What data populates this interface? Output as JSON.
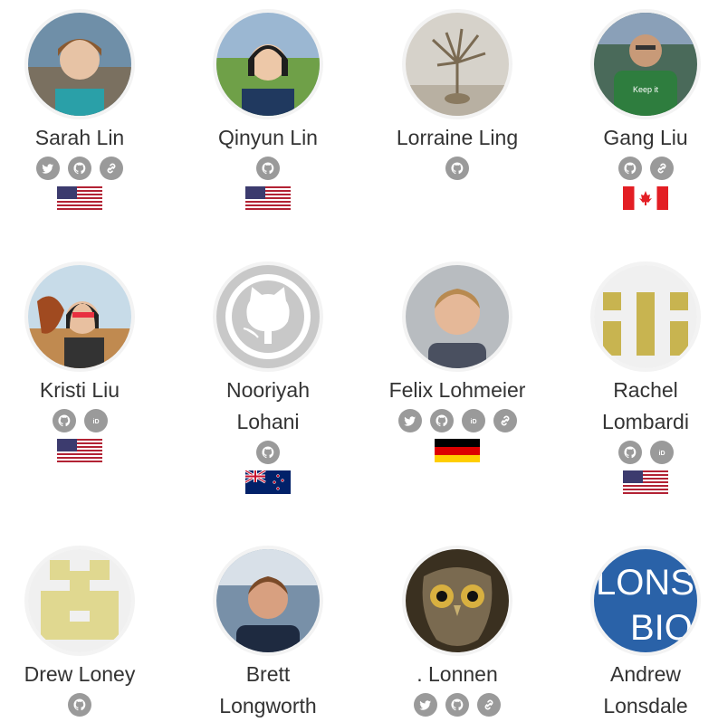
{
  "people": [
    {
      "name": "Sarah Lin",
      "links": [
        "twitter-icon",
        "github-icon",
        "website-link-icon"
      ],
      "country": "United States"
    },
    {
      "name": "Qinyun Lin",
      "links": [
        "github-icon"
      ],
      "country": "United States"
    },
    {
      "name": "Lorraine Ling",
      "links": [
        "github-icon"
      ],
      "country": ""
    },
    {
      "name": "Gang Liu",
      "links": [
        "github-icon",
        "website-link-icon"
      ],
      "country": "Canada"
    },
    {
      "name": "Kristi Liu",
      "links": [
        "github-icon",
        "orcid-icon"
      ],
      "country": "United States"
    },
    {
      "name_line1": "Nooriyah",
      "name_line2": "Lohani",
      "links": [
        "github-icon"
      ],
      "country": "New Zealand"
    },
    {
      "name": "Felix Lohmeier",
      "links": [
        "twitter-icon",
        "github-icon",
        "orcid-icon",
        "website-link-icon"
      ],
      "country": "Germany"
    },
    {
      "name_line1": "Rachel",
      "name_line2": "Lombardi",
      "links": [
        "github-icon",
        "orcid-icon"
      ],
      "country": "United States"
    },
    {
      "name": "Drew Loney",
      "links": [
        "github-icon"
      ],
      "country": ""
    },
    {
      "name_line1": "Brett",
      "name_line2": "Longworth",
      "links": [],
      "country": ""
    },
    {
      "name": ". Lonnen",
      "links": [
        "twitter-icon",
        "github-icon",
        "website-link-icon"
      ],
      "country": ""
    },
    {
      "name_line1": "Andrew",
      "name_line2": "Lonsdale",
      "links": [],
      "country": ""
    }
  ],
  "avatar_text": {
    "andrew": [
      "LONS",
      "BIO"
    ]
  },
  "colors": {
    "icon_bg": "#9a9a9a",
    "text": "#333333",
    "avatar_ring": "#f3f3f3"
  }
}
